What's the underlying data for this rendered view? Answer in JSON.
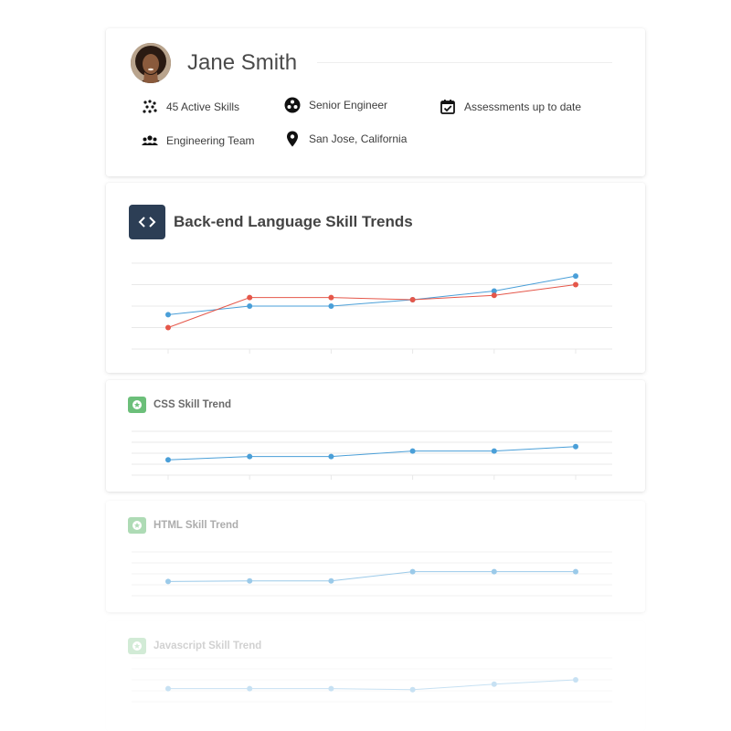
{
  "profile": {
    "name": "Jane Smith",
    "info": [
      {
        "icon": "skills-icon",
        "label": "45 Active Skills"
      },
      {
        "icon": "role-icon",
        "label": "Senior Engineer"
      },
      {
        "icon": "calendar-check-icon",
        "label": "Assessments up to date"
      },
      {
        "icon": "team-icon",
        "label": "Engineering Team"
      },
      {
        "icon": "location-pin-icon",
        "label": "San Jose, California"
      }
    ]
  },
  "colors": {
    "blue": "#4a9fd8",
    "red": "#e5574a",
    "grid": "#e8e8e8",
    "tile_dark": "#2c3e55",
    "tile_green": "#6cbf7a"
  },
  "chart_data": [
    {
      "type": "line",
      "title": "Back-end Language Skill Trends",
      "x": [
        1,
        2,
        3,
        4,
        5,
        6
      ],
      "ylim": [
        0,
        4
      ],
      "grid": true,
      "series": [
        {
          "color": "#4a9fd8",
          "values": [
            1.6,
            2.0,
            2.0,
            2.3,
            2.7,
            3.4
          ]
        },
        {
          "color": "#e5574a",
          "values": [
            1.0,
            2.4,
            2.4,
            2.3,
            2.5,
            3.0
          ]
        }
      ]
    },
    {
      "type": "line",
      "title": "CSS Skill Trend",
      "x": [
        1,
        2,
        3,
        4,
        5,
        6
      ],
      "ylim": [
        0,
        4
      ],
      "grid": true,
      "series": [
        {
          "color": "#4a9fd8",
          "values": [
            1.4,
            1.7,
            1.7,
            2.2,
            2.2,
            2.6
          ]
        }
      ]
    },
    {
      "type": "line",
      "title": "HTML Skill Trend",
      "x": [
        1,
        2,
        3,
        4,
        5,
        6
      ],
      "ylim": [
        0,
        4
      ],
      "grid": true,
      "series": [
        {
          "color": "#4a9fd8",
          "values": [
            1.3,
            1.35,
            1.35,
            2.2,
            2.2,
            2.2
          ]
        }
      ]
    },
    {
      "type": "line",
      "title": "Javascript Skill Trend",
      "x": [
        1,
        2,
        3,
        4,
        5,
        6
      ],
      "ylim": [
        0,
        4
      ],
      "grid": true,
      "series": [
        {
          "color": "#4a9fd8",
          "values": [
            1.2,
            1.2,
            1.2,
            1.1,
            1.6,
            2.0
          ]
        }
      ]
    }
  ]
}
